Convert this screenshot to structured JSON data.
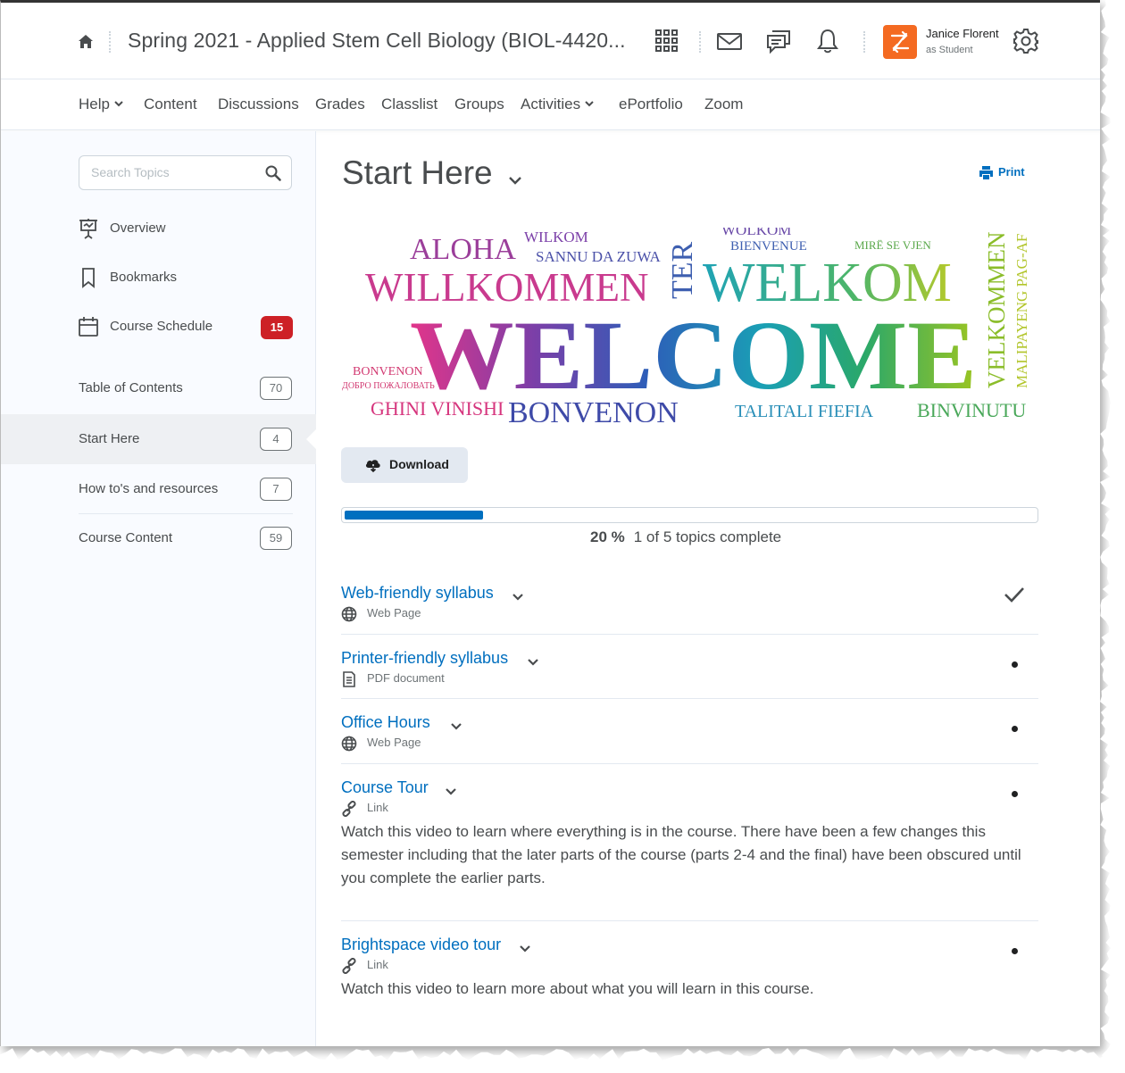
{
  "header": {
    "course_title": "Spring 2021 - Applied Stem Cell Biology (BIOL-4420...",
    "user_name": "Janice Florent",
    "user_role": "as Student"
  },
  "nav": {
    "items": [
      {
        "label": "Help",
        "dropdown": true
      },
      {
        "label": "Content",
        "dropdown": false
      },
      {
        "label": "Discussions",
        "dropdown": false
      },
      {
        "label": "Grades",
        "dropdown": false
      },
      {
        "label": "Classlist",
        "dropdown": false
      },
      {
        "label": "Groups",
        "dropdown": false
      },
      {
        "label": "Activities",
        "dropdown": true
      },
      {
        "label": "ePortfolio",
        "dropdown": false
      },
      {
        "label": "Zoom",
        "dropdown": false
      }
    ]
  },
  "sidebar": {
    "search_placeholder": "Search Topics",
    "links": [
      {
        "label": "Overview",
        "icon": "overview-icon"
      },
      {
        "label": "Bookmarks",
        "icon": "bookmark-icon"
      },
      {
        "label": "Course Schedule",
        "icon": "calendar-icon",
        "badge": "15"
      }
    ],
    "toc": [
      {
        "label": "Table of Contents",
        "count": "70"
      },
      {
        "label": "Start Here",
        "count": "4",
        "active": true
      },
      {
        "label": "How to's and resources",
        "count": "7"
      },
      {
        "label": "Course Content",
        "count": "59"
      }
    ]
  },
  "main": {
    "title": "Start Here",
    "print_label": "Print",
    "download_label": "Download",
    "banner_words": {
      "welcome": "WELCOME",
      "willkommen": "WILLKOMMEN",
      "welkom": "WELKOM",
      "aloha": "ALOHA",
      "wilkom": "WILKOM",
      "sannu": "SANNU DA ZUWA",
      "bienvenue": "BIENVENUE",
      "mire": "MIRË SE VJEN",
      "ter": "TER",
      "bonvenon_small": "BONVENON",
      "dobro": "ДОБРО ПОЖАЛОВАТЬ",
      "ghini": "GHINI VINISHI",
      "bonvenon": "BONVENON",
      "talitali": "TALITALI FIEFIA",
      "binvinutu": "BINVINUTU",
      "velkommen": "VELKOMMEN",
      "malipayeng": "MALIPAYENG PAG-AF",
      "welkom_top": "WOLKOM"
    },
    "progress": {
      "percent_label": "20 %",
      "complete_label": "1 of 5 topics complete",
      "fraction": 0.2
    },
    "topics": [
      {
        "title": "Web-friendly syllabus",
        "type": "Web Page",
        "icon": "globe-icon",
        "status": "complete",
        "desc": ""
      },
      {
        "title": "Printer-friendly syllabus",
        "type": "PDF document",
        "icon": "document-icon",
        "status": "incomplete",
        "desc": ""
      },
      {
        "title": "Office Hours",
        "type": "Web Page",
        "icon": "globe-icon",
        "status": "incomplete",
        "desc": ""
      },
      {
        "title": "Course Tour",
        "type": "Link",
        "icon": "link-icon",
        "status": "incomplete",
        "desc": "Watch this video to learn where everything is in the course.  There have been a few changes this semester including that the later parts of the course (parts 2-4 and the final) have been obscured until you complete the earlier parts."
      },
      {
        "title": "Brightspace video tour",
        "type": "Link",
        "icon": "link-icon",
        "status": "incomplete",
        "desc": "Watch this video to learn more about what you will learn in this course."
      }
    ]
  },
  "colors": {
    "link": "#006fbf",
    "badge_red": "#cd2026",
    "user_tile": "#f46a21",
    "progress_fill": "#006fbf"
  }
}
